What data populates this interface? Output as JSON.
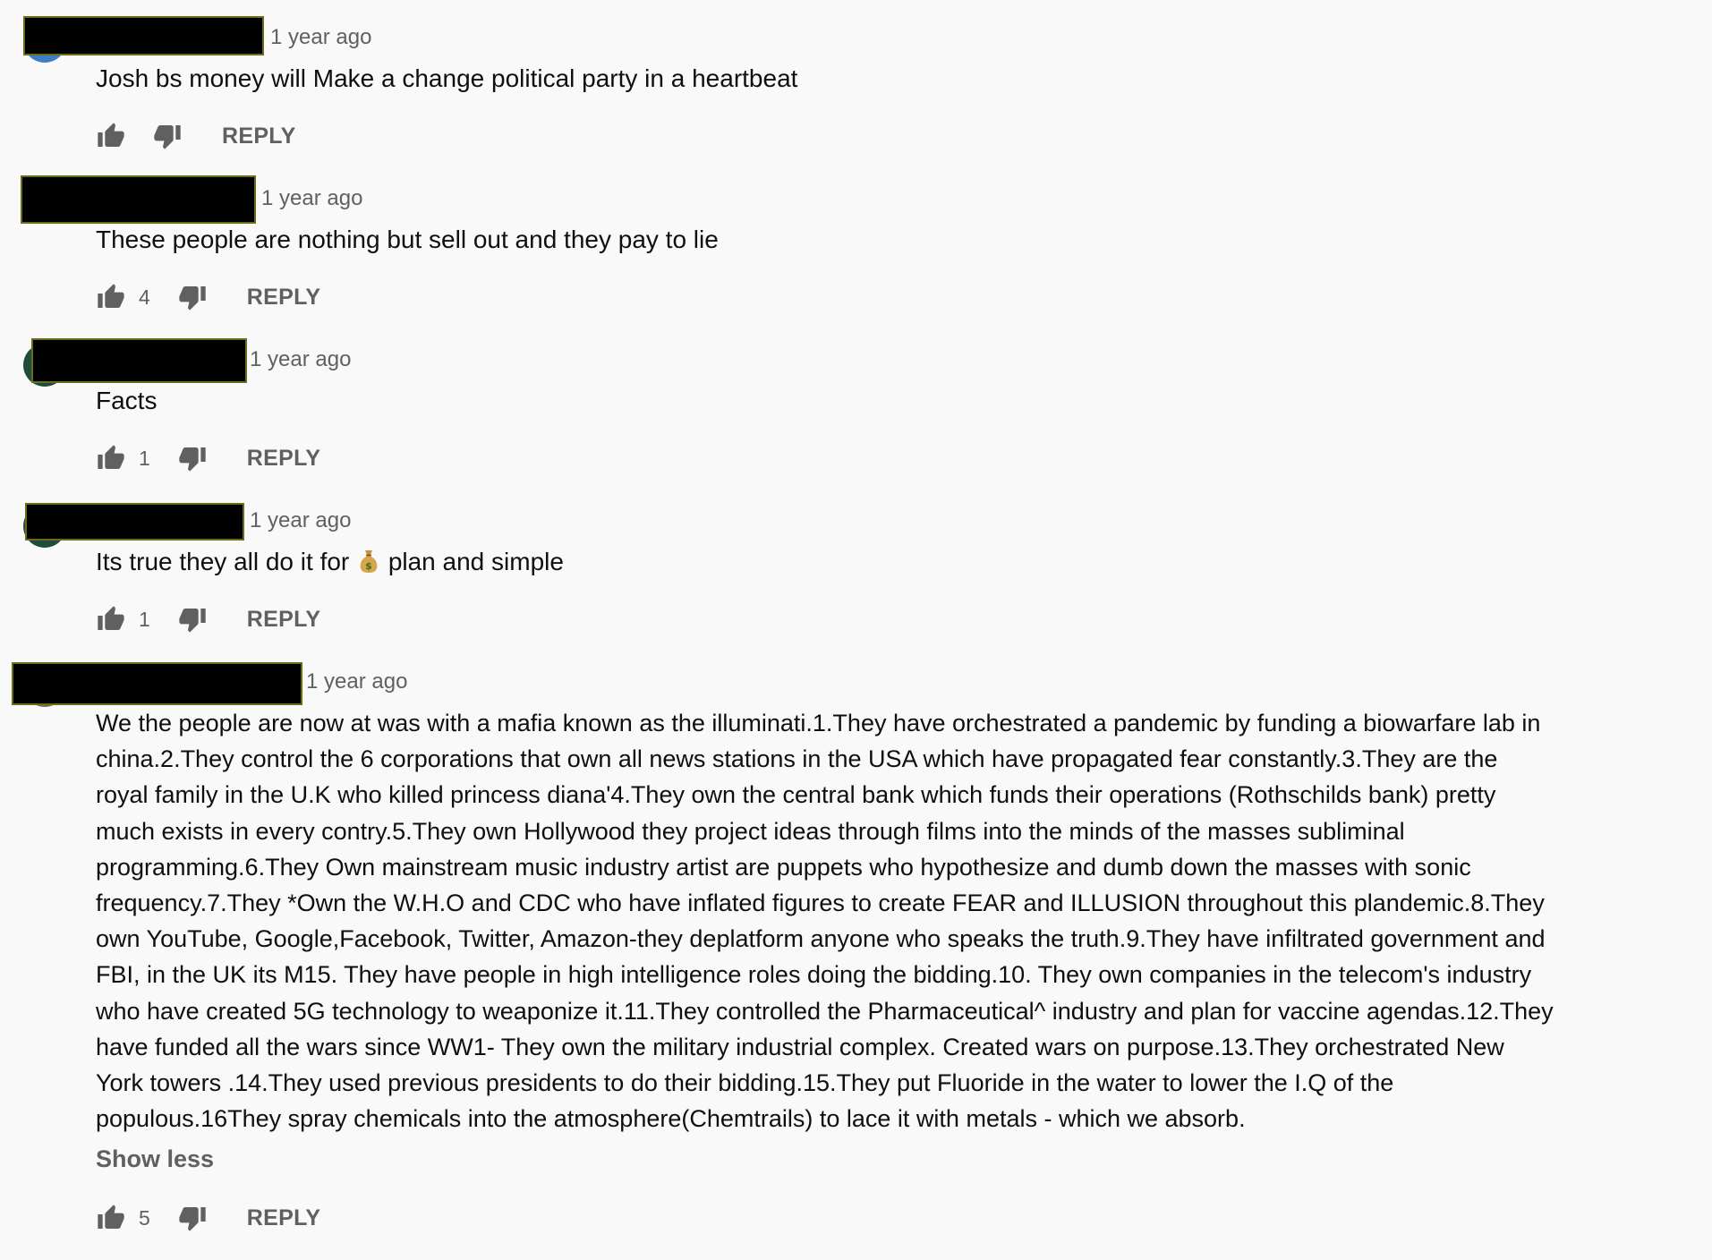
{
  "comments": [
    {
      "timestamp": "1 year ago",
      "text": "Josh bs money will Make a change political party in a heartbeat",
      "likes": "",
      "reply_label": "REPLY"
    },
    {
      "timestamp": "1 year ago",
      "text": "These people are nothing but sell out and they pay to lie",
      "likes": "4",
      "reply_label": "REPLY"
    },
    {
      "timestamp": "1 year ago",
      "text": "Facts",
      "likes": "1",
      "reply_label": "REPLY"
    },
    {
      "timestamp": "1 year ago",
      "text_before_emoji": "Its true they all do it for",
      "emoji": "money-bag-emoji",
      "text_after_emoji": "plan and simple",
      "likes": "1",
      "reply_label": "REPLY"
    },
    {
      "timestamp": "1 year ago",
      "lines": [
        "We the people are now at was with a mafia known as the illuminati.1.They have orchestrated a pandemic by funding a biowarfare lab in",
        "china.2.They control the 6 corporations that own all news stations in the USA which have propagated fear constantly.3.They are the",
        "royal family in the U.K who killed princess diana'4.They own the central bank which funds their operations (Rothschilds bank) pretty",
        "much exists in every contry.5.They own Hollywood they project ideas through films into the minds of the masses subliminal",
        "programming.6.They Own mainstream music industry artist are puppets who hypothesize and dumb down the masses with sonic",
        "frequency.7.They *Own the W.H.O and CDC who have inflated figures to create FEAR and ILLUSION throughout this plandemic.8.They",
        "own YouTube, Google,Facebook, Twitter, Amazon-they deplatform anyone who speaks the truth.9.They have infiltrated government and",
        "FBI, in the UK its M15. They have people in high intelligence roles doing the bidding.10. They own companies in the telecom's industry",
        "who have created 5G technology to weaponize it.11.They controlled the Pharmaceutical^ industry and plan for vaccine agendas.12.They",
        "have funded all the wars since WW1- They own the military industrial complex. Created wars on purpose.13.They orchestrated New",
        "York towers .14.They used previous presidents to do their bidding.15.They put Fluoride in the water to lower the I.Q of the",
        "populous.16They spray chemicals into the atmosphere(Chemtrails) to lace it with metals - which we absorb."
      ],
      "show_less_label": "Show less",
      "likes": "5",
      "reply_label": "REPLY"
    }
  ],
  "icons": {
    "like": "thumbs-up-icon",
    "dislike": "thumbs-down-icon"
  },
  "colors": {
    "background": "#f9f9f9",
    "text": "#0f0f0f",
    "secondary_text": "#606060",
    "redaction": "#000000"
  }
}
